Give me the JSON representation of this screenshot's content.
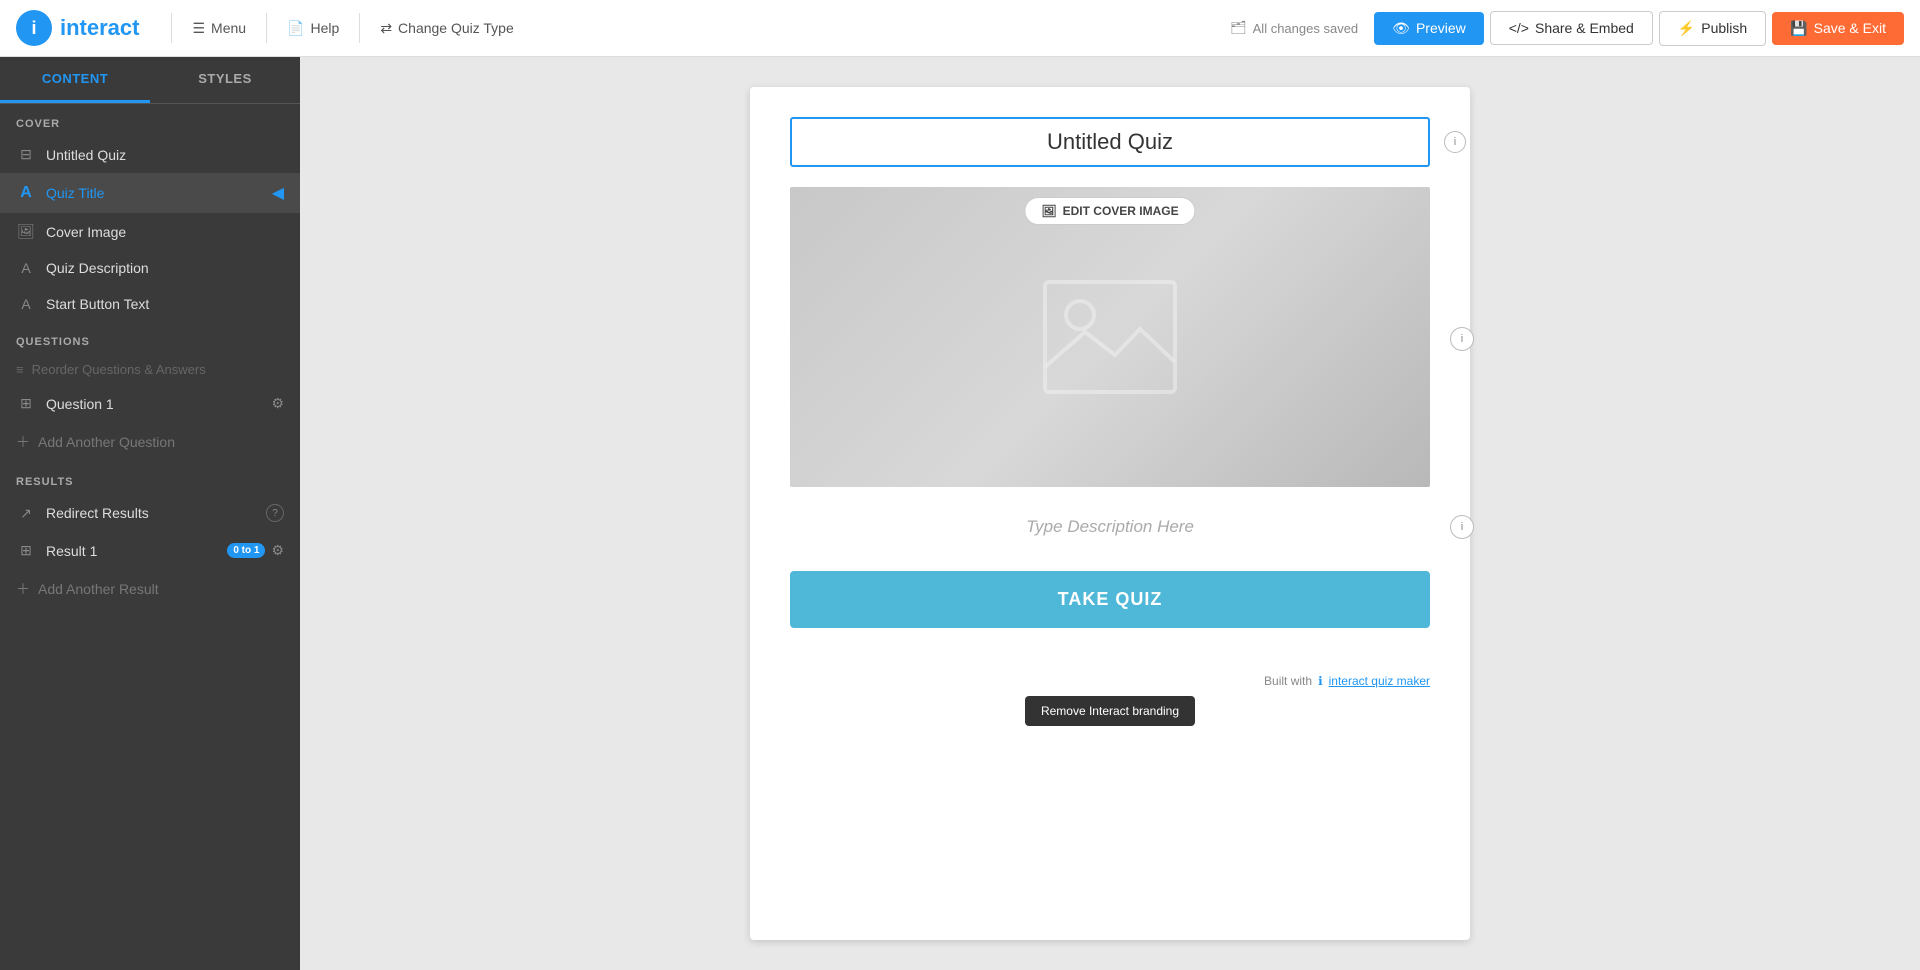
{
  "navbar": {
    "logo_text": "interact",
    "menu_label": "Menu",
    "help_label": "Help",
    "change_quiz_type_label": "Change Quiz Type",
    "status_text": "All changes saved",
    "preview_label": "Preview",
    "share_embed_label": "Share & Embed",
    "publish_label": "Publish",
    "save_exit_label": "Save & Exit"
  },
  "sidebar": {
    "content_tab": "CONTENT",
    "styles_tab": "STYLES",
    "cover_section": "COVER",
    "untitled_quiz_label": "Untitled Quiz",
    "quiz_title_label": "Quiz Title",
    "cover_image_label": "Cover Image",
    "quiz_description_label": "Quiz Description",
    "start_button_text_label": "Start Button Text",
    "questions_section": "QUESTIONS",
    "reorder_label": "Reorder Questions & Answers",
    "question_1_label": "Question 1",
    "add_question_label": "Add Another Question",
    "results_section": "RESULTS",
    "redirect_results_label": "Redirect Results",
    "result_1_label": "Result 1",
    "result_1_badge": "0 to 1",
    "add_result_label": "Add Another Result"
  },
  "main": {
    "quiz_title_value": "Untitled Quiz",
    "quiz_title_placeholder": "Untitled Quiz",
    "edit_cover_image_label": "EDIT COVER IMAGE",
    "description_placeholder": "Type Description Here",
    "take_quiz_label": "TAKE QUIZ",
    "branding_text": "Built with",
    "branding_link": "interact quiz maker",
    "remove_branding_label": "Remove Interact branding"
  }
}
